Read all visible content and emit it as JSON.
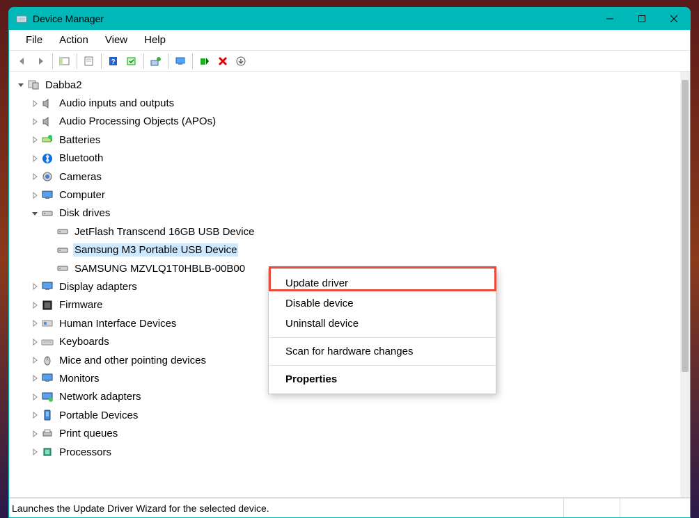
{
  "title": "Device Manager",
  "menubar": [
    "File",
    "Action",
    "View",
    "Help"
  ],
  "tree": {
    "root": "Dabba2",
    "categories": [
      {
        "label": "Audio inputs and outputs",
        "icon": "speaker"
      },
      {
        "label": "Audio Processing Objects (APOs)",
        "icon": "speaker"
      },
      {
        "label": "Batteries",
        "icon": "battery"
      },
      {
        "label": "Bluetooth",
        "icon": "bluetooth"
      },
      {
        "label": "Cameras",
        "icon": "camera"
      },
      {
        "label": "Computer",
        "icon": "monitor"
      },
      {
        "label": "Disk drives",
        "icon": "disk",
        "expanded": true,
        "children": [
          {
            "label": "JetFlash Transcend 16GB USB Device"
          },
          {
            "label": "Samsung M3 Portable USB Device",
            "selected": true
          },
          {
            "label": "SAMSUNG MZVLQ1T0HBLB-00B00"
          }
        ]
      },
      {
        "label": "Display adapters",
        "icon": "display"
      },
      {
        "label": "Firmware",
        "icon": "firmware"
      },
      {
        "label": "Human Interface Devices",
        "icon": "hid"
      },
      {
        "label": "Keyboards",
        "icon": "keyboard"
      },
      {
        "label": "Mice and other pointing devices",
        "icon": "mouse"
      },
      {
        "label": "Monitors",
        "icon": "monitor"
      },
      {
        "label": "Network adapters",
        "icon": "network"
      },
      {
        "label": "Portable Devices",
        "icon": "portable"
      },
      {
        "label": "Print queues",
        "icon": "printer"
      },
      {
        "label": "Processors",
        "icon": "cpu"
      }
    ]
  },
  "context_menu": {
    "items": [
      "Update driver",
      "Disable device",
      "Uninstall device",
      "---",
      "Scan for hardware changes",
      "---",
      "Properties"
    ],
    "bold_index": 6
  },
  "statusbar": "Launches the Update Driver Wizard for the selected device."
}
